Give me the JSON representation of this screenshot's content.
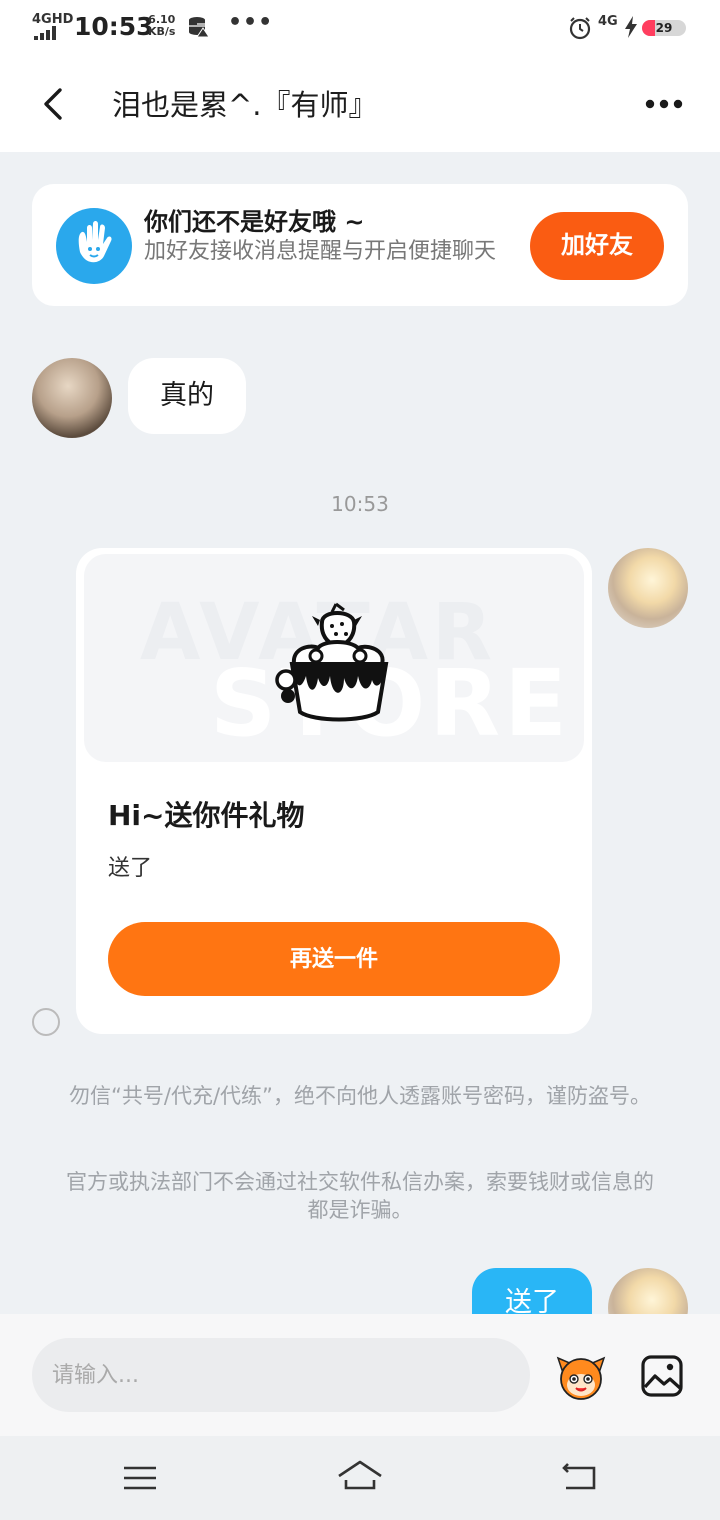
{
  "status_bar": {
    "network": "4GHD",
    "time": "10:53",
    "speed_value": "6.10",
    "speed_unit": "KB/s",
    "more": "•••",
    "network_right": "4G",
    "battery": "29",
    "battery_level": 0.29,
    "battery_color": "#ff3e5f"
  },
  "header": {
    "title": "泪也是累^.『有师』",
    "back_icon": "chevron-left-icon",
    "more_icon": "ellipsis-icon"
  },
  "friend_card": {
    "title": "你们还不是好友哦 ~",
    "subtitle": "加好友接收消息提醒与开启便捷聊天",
    "button": "加好友",
    "accent": "#fa5c12",
    "icon": "waving-hand-icon"
  },
  "messages": {
    "incoming_text": "真的",
    "timestamp": "10:53",
    "gift_card": {
      "watermark_line1": "AVATAR",
      "watermark_line2": "STORE",
      "title": "Hi~送你件礼物",
      "subtitle": "送了",
      "button": "再送一件",
      "button_color": "#ff7512"
    },
    "outgoing_text": "送了",
    "outgoing_color": "#29b6f6"
  },
  "notices": {
    "line1": "勿信“共号/代充/代练”，绝不向他人透露账号密码，谨防盗号。",
    "line2": "官方或执法部门不会通过社交软件私信办案，索要钱财或信息的都是诈骗。"
  },
  "input_bar": {
    "placeholder": "请输入...",
    "emoji_icon": "emoji-mascot-icon",
    "image_icon": "image-icon"
  },
  "nav_bar": {
    "menu_icon": "menu-icon",
    "home_icon": "home-icon",
    "back_icon": "back-icon"
  }
}
